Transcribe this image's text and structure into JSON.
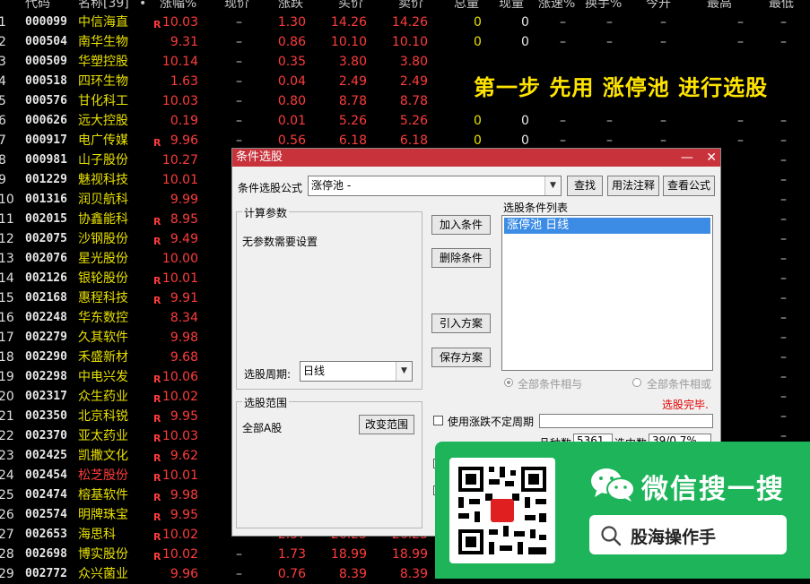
{
  "header": {
    "code": "代码",
    "name": "名称[39]",
    "dot": "•",
    "pct": "涨幅%",
    "now": "现价",
    "chg": "涨跌",
    "bid": "买价",
    "ask": "卖价",
    "vol": "总量",
    "cur": "现量",
    "speed": "涨速%",
    "turn": "换手%",
    "open": "今开",
    "high": "最高",
    "low": "最低"
  },
  "rows": [
    {
      "idx": "1",
      "code": "000099",
      "name": "中信海直",
      "r": "R",
      "pct": "10.03",
      "dash": "–",
      "chg": "1.30",
      "bid": "14.26",
      "ask": "14.26",
      "vol": "0",
      "cur": "0",
      "d1": "–",
      "d2": "–",
      "d3": "–",
      "d4": "–",
      "d5": "–"
    },
    {
      "idx": "2",
      "code": "000504",
      "name": "南华生物",
      "r": "",
      "pct": "9.31",
      "dash": "–",
      "chg": "0.86",
      "bid": "10.10",
      "ask": "10.10",
      "vol": "0",
      "cur": "0",
      "d1": "–",
      "d2": "–",
      "d3": "–",
      "d4": "–",
      "d5": "–"
    },
    {
      "idx": "3",
      "code": "000509",
      "name": "华塑控股",
      "r": "",
      "pct": "10.14",
      "dash": "–",
      "chg": "0.35",
      "bid": "3.80",
      "ask": "3.80",
      "vol": "",
      "cur": "",
      "d1": "",
      "d2": "",
      "d3": "",
      "d4": "",
      "d5": ""
    },
    {
      "idx": "4",
      "code": "000518",
      "name": "四环生物",
      "r": "",
      "pct": "1.63",
      "dash": "–",
      "chg": "0.04",
      "bid": "2.49",
      "ask": "2.49",
      "vol": "",
      "cur": "",
      "d1": "",
      "d2": "",
      "d3": "",
      "d4": "",
      "d5": ""
    },
    {
      "idx": "5",
      "code": "000576",
      "name": "甘化科工",
      "r": "",
      "pct": "10.03",
      "dash": "–",
      "chg": "0.80",
      "bid": "8.78",
      "ask": "8.78",
      "vol": "",
      "cur": "",
      "d1": "",
      "d2": "",
      "d3": "",
      "d4": "",
      "d5": ""
    },
    {
      "idx": "6",
      "code": "000626",
      "name": "远大控股",
      "r": "",
      "pct": "0.19",
      "dash": "–",
      "chg": "0.01",
      "bid": "5.26",
      "ask": "5.26",
      "vol": "0",
      "cur": "0",
      "d1": "–",
      "d2": "–",
      "d3": "–",
      "d4": "–",
      "d5": "–"
    },
    {
      "idx": "7",
      "code": "000917",
      "name": "电广传媒",
      "r": "R",
      "pct": "9.96",
      "dash": "–",
      "chg": "0.56",
      "bid": "6.18",
      "ask": "6.18",
      "vol": "0",
      "cur": "0",
      "d1": "–",
      "d2": "–",
      "d3": "–",
      "d4": "–",
      "d5": "–"
    },
    {
      "idx": "8",
      "code": "000981",
      "name": "山子股份",
      "r": "",
      "pct": "10.27",
      "dash": "",
      "chg": "",
      "bid": "",
      "ask": "",
      "vol": "",
      "cur": "",
      "d1": "",
      "d2": "",
      "d3": "",
      "d4": "",
      "d5": "–"
    },
    {
      "idx": "9",
      "code": "001229",
      "name": "魅视科技",
      "r": "",
      "pct": "10.01",
      "dash": "",
      "chg": "",
      "bid": "",
      "ask": "",
      "vol": "",
      "cur": "",
      "d1": "",
      "d2": "",
      "d3": "",
      "d4": "",
      "d5": "–"
    },
    {
      "idx": "10",
      "code": "001316",
      "name": "润贝航科",
      "r": "",
      "pct": "9.99",
      "dash": "",
      "chg": "",
      "bid": "",
      "ask": "",
      "vol": "",
      "cur": "",
      "d1": "",
      "d2": "",
      "d3": "",
      "d4": "",
      "d5": "–"
    },
    {
      "idx": "11",
      "code": "002015",
      "name": "协鑫能科",
      "r": "R",
      "pct": "8.95",
      "dash": "",
      "chg": "",
      "bid": "",
      "ask": "",
      "vol": "",
      "cur": "",
      "d1": "",
      "d2": "",
      "d3": "",
      "d4": "",
      "d5": "–"
    },
    {
      "idx": "12",
      "code": "002075",
      "name": "沙钢股份",
      "r": "R",
      "pct": "9.49",
      "dash": "",
      "chg": "",
      "bid": "",
      "ask": "",
      "vol": "",
      "cur": "",
      "d1": "",
      "d2": "",
      "d3": "",
      "d4": "",
      "d5": "–"
    },
    {
      "idx": "13",
      "code": "002076",
      "name": "星光股份",
      "r": "",
      "pct": "10.00",
      "dash": "",
      "chg": "",
      "bid": "",
      "ask": "",
      "vol": "",
      "cur": "",
      "d1": "",
      "d2": "",
      "d3": "",
      "d4": "",
      "d5": "–"
    },
    {
      "idx": "14",
      "code": "002126",
      "name": "银轮股份",
      "r": "R",
      "pct": "10.01",
      "dash": "",
      "chg": "",
      "bid": "",
      "ask": "",
      "vol": "",
      "cur": "",
      "d1": "",
      "d2": "",
      "d3": "",
      "d4": "",
      "d5": "–"
    },
    {
      "idx": "15",
      "code": "002168",
      "name": "惠程科技",
      "r": "R",
      "pct": "9.91",
      "dash": "",
      "chg": "",
      "bid": "",
      "ask": "",
      "vol": "",
      "cur": "",
      "d1": "",
      "d2": "",
      "d3": "",
      "d4": "",
      "d5": "–"
    },
    {
      "idx": "16",
      "code": "002248",
      "name": "华东数控",
      "r": "",
      "pct": "8.34",
      "dash": "",
      "chg": "",
      "bid": "",
      "ask": "",
      "vol": "",
      "cur": "",
      "d1": "",
      "d2": "",
      "d3": "",
      "d4": "",
      "d5": "–"
    },
    {
      "idx": "17",
      "code": "002279",
      "name": "久其软件",
      "r": "",
      "pct": "9.98",
      "dash": "",
      "chg": "",
      "bid": "",
      "ask": "",
      "vol": "",
      "cur": "",
      "d1": "",
      "d2": "",
      "d3": "",
      "d4": "",
      "d5": "–"
    },
    {
      "idx": "18",
      "code": "002290",
      "name": "禾盛新材",
      "r": "",
      "pct": "9.68",
      "dash": "",
      "chg": "",
      "bid": "",
      "ask": "",
      "vol": "",
      "cur": "",
      "d1": "",
      "d2": "",
      "d3": "",
      "d4": "",
      "d5": "–"
    },
    {
      "idx": "19",
      "code": "002298",
      "name": "中电兴发",
      "r": "R",
      "pct": "10.06",
      "dash": "",
      "chg": "",
      "bid": "",
      "ask": "",
      "vol": "",
      "cur": "",
      "d1": "",
      "d2": "",
      "d3": "",
      "d4": "",
      "d5": "–"
    },
    {
      "idx": "20",
      "code": "002317",
      "name": "众生药业",
      "r": "R",
      "pct": "10.02",
      "dash": "",
      "chg": "",
      "bid": "",
      "ask": "",
      "vol": "",
      "cur": "",
      "d1": "",
      "d2": "",
      "d3": "",
      "d4": "",
      "d5": "–"
    },
    {
      "idx": "21",
      "code": "002350",
      "name": "北京科锐",
      "r": "R",
      "pct": "9.95",
      "dash": "",
      "chg": "",
      "bid": "",
      "ask": "",
      "vol": "",
      "cur": "",
      "d1": "",
      "d2": "",
      "d3": "",
      "d4": "",
      "d5": "–"
    },
    {
      "idx": "22",
      "code": "002370",
      "name": "亚太药业",
      "r": "R",
      "pct": "10.03",
      "dash": "",
      "chg": "",
      "bid": "",
      "ask": "",
      "vol": "",
      "cur": "",
      "d1": "",
      "d2": "",
      "d3": "",
      "d4": "",
      "d5": "–"
    },
    {
      "idx": "23",
      "code": "002425",
      "name": "凯撒文化",
      "r": "R",
      "pct": "9.62",
      "dash": "",
      "chg": "",
      "bid": "",
      "ask": "",
      "vol": "",
      "cur": "",
      "d1": "",
      "d2": "",
      "d3": "",
      "d4": "",
      "d5": "–"
    },
    {
      "idx": "24",
      "code": "002454",
      "name": "松芝股份",
      "r": "R",
      "pct": "10.01",
      "dash": "",
      "chg": "",
      "bid": "",
      "ask": "",
      "vol": "",
      "cur": "",
      "d1": "",
      "d2": "",
      "d3": "",
      "d4": "",
      "d5": ""
    },
    {
      "idx": "25",
      "code": "002474",
      "name": "榕基软件",
      "r": "R",
      "pct": "9.98",
      "dash": "",
      "chg": "",
      "bid": "",
      "ask": "",
      "vol": "",
      "cur": "",
      "d1": "",
      "d2": "",
      "d3": "",
      "d4": "",
      "d5": ""
    },
    {
      "idx": "26",
      "code": "002574",
      "name": "明牌珠宝",
      "r": "R",
      "pct": "9.95",
      "dash": "",
      "chg": "",
      "bid": "",
      "ask": "",
      "vol": "",
      "cur": "",
      "d1": "",
      "d2": "",
      "d3": "",
      "d4": "",
      "d5": ""
    },
    {
      "idx": "27",
      "code": "002653",
      "name": "海思科",
      "r": "R",
      "pct": "10.02",
      "dash": "",
      "chg": "2.37",
      "bid": "26.25",
      "ask": "26.25",
      "vol": "",
      "cur": "",
      "d1": "",
      "d2": "",
      "d3": "",
      "d4": "",
      "d5": ""
    },
    {
      "idx": "28",
      "code": "002698",
      "name": "博实股份",
      "r": "R",
      "pct": "10.02",
      "dash": "–",
      "chg": "1.73",
      "bid": "18.99",
      "ask": "18.99",
      "vol": "",
      "cur": "",
      "d1": "",
      "d2": "",
      "d3": "",
      "d4": "",
      "d5": ""
    },
    {
      "idx": "29",
      "code": "002772",
      "name": "众兴菌业",
      "r": "",
      "pct": "9.96",
      "dash": "–",
      "chg": "0.76",
      "bid": "8.39",
      "ask": "8.39",
      "vol": "",
      "cur": "",
      "d1": "",
      "d2": "",
      "d3": "",
      "d4": "",
      "d5": ""
    }
  ],
  "highlight_color": "#ff3c3c",
  "banner": "第一步 先用 涨停池 进行选股",
  "dialog": {
    "title": "条件选股",
    "minimize": "—",
    "close": "✕",
    "formula_label": "条件选股公式",
    "formula_value": "涨停池        -",
    "find_btn": "查找",
    "usage_btn": "用法注释",
    "view_btn": "查看公式",
    "params_group": "计算参数",
    "no_params": "无参数需要设置",
    "add_btn": "加入条件",
    "del_btn": "删除条件",
    "import_btn": "引入方案",
    "save_btn": "保存方案",
    "list_label": "选股条件列表",
    "list_item": "涨停池  日线",
    "period_label": "选股周期:",
    "period_value": "日线",
    "radio_and": "全部条件相与",
    "radio_or": "全部条件相或",
    "done": "选股完毕.",
    "range_group": "选股范围",
    "range_value": "全部A股",
    "change_range_btn": "改变范围",
    "use_period_label": "使用涨跌不定周期",
    "count_label": "品种数",
    "count_value": "5361",
    "selected_label": "选中数",
    "selected_value": "39/0.7%"
  },
  "wechat": {
    "title": "微信搜一搜",
    "search_text": "股海操作手"
  }
}
